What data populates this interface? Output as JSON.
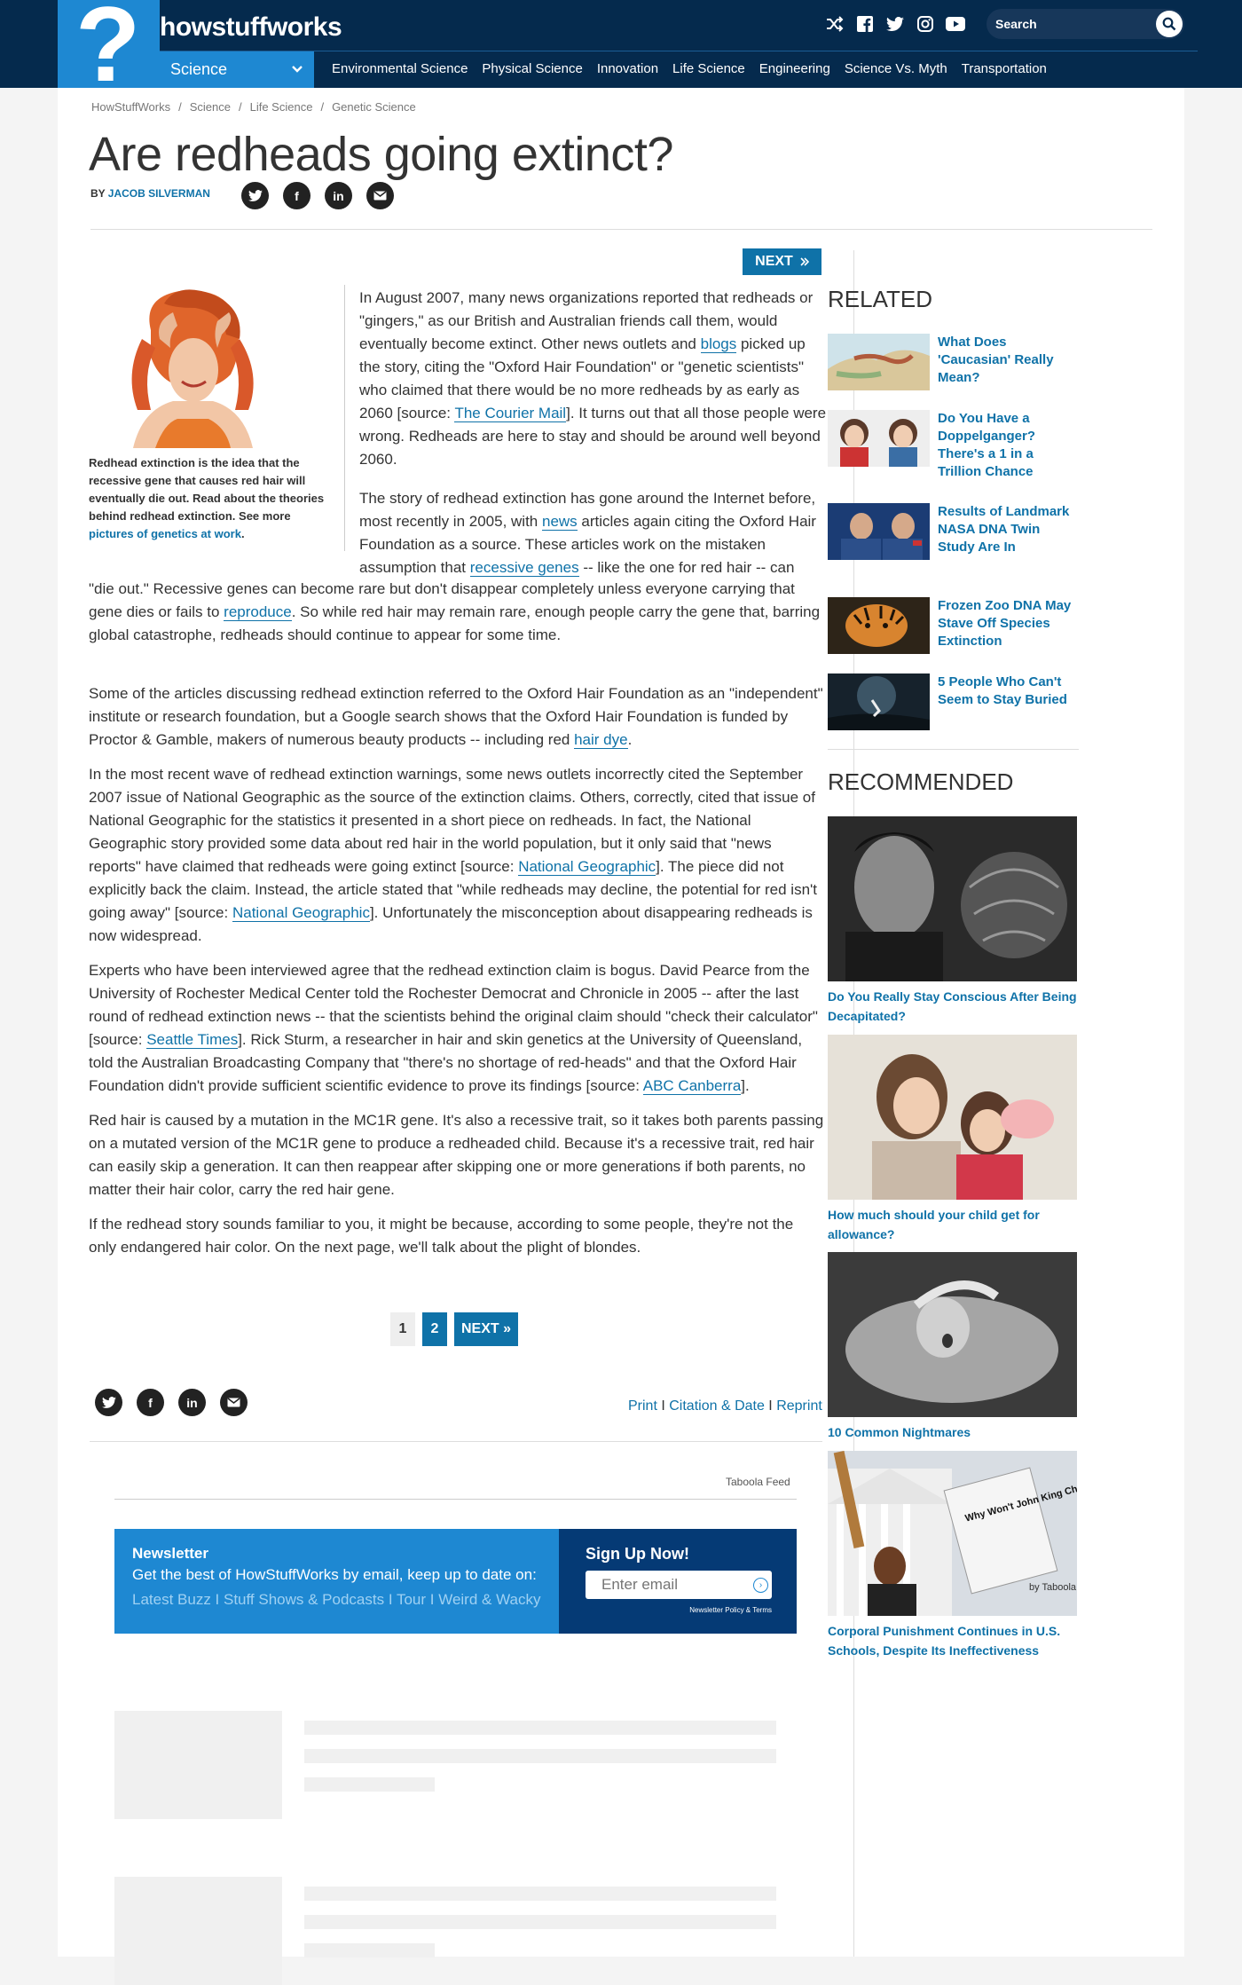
{
  "header": {
    "brand": "howstuffworks",
    "search_placeholder": "Search",
    "category": "Science",
    "nav": [
      "Environmental Science",
      "Physical Science",
      "Innovation",
      "Life Science",
      "Engineering",
      "Science Vs. Myth",
      "Transportation"
    ]
  },
  "breadcrumbs": [
    "HowStuffWorks",
    "Science",
    "Life Science",
    "Genetic Science"
  ],
  "article": {
    "title": "Are redheads going extinct?",
    "by_label": "BY",
    "author": "JACOB SILVERMAN",
    "next_label": "NEXT",
    "caption_text": "Redhead extinction is the idea that the recessive gene that causes red hair will eventually die out. Read about the theories behind redhead extinction. See more ",
    "caption_link": "pictures of genetics at work",
    "caption_end": ".",
    "p1": [
      "In August 2007, many news organizations reported that redheads or \"gingers,\" as our British and Australian friends call them, would eventually become extinct. Other news outlets and ",
      "blogs",
      " picked up the story, citing the \"Oxford Hair Foundation\" or \"genetic scientists\" who claimed that there would be no more redheads by as early as 2060 [source: ",
      "The Courier Mail",
      "]. It turns out that all those people were wrong. Redheads are here to stay and should be around well beyond 2060."
    ],
    "p2a": [
      "The story of redhead extinction has gone around the Internet before, most recently in 2005, with ",
      "news",
      " articles again citing the Oxford Hair Foundation as a source. These articles work on the mistaken assumption that ",
      "recessive genes",
      " -- like the one for red hair -- can"
    ],
    "p2b": [
      "\"die out.\" Recessive genes can become rare but don't disappear completely unless everyone carrying that gene dies or fails to ",
      "reproduce",
      ". So while red hair may remain rare, enough people carry the gene that, barring global catastrophe, redheads should continue to appear for some time."
    ],
    "p3": [
      "Some of the articles discussing redhead extinction referred to the Oxford Hair Foundation as an \"independent\" institute or research foundation, but a Google search shows that the Oxford Hair Foundation is funded by Proctor & Gamble, makers of numerous beauty products -- including red ",
      "hair dye",
      "."
    ],
    "p4": [
      "In the most recent wave of redhead extinction warnings, some news outlets incorrectly cited the September 2007 issue of National Geographic as the source of the extinction claims. Others, correctly, cited that issue of National Geographic for the statistics it presented in a short piece on redheads. In fact, the National Geographic story provided some data about red hair in the world population, but it only said that \"news reports\" have claimed that redheads were going extinct [source: ",
      "National Geographic",
      "]. The piece did not explicitly back the claim. Instead, the article stated that \"while redheads may decline, the potential for red isn't going away\" [source: ",
      "National Geographic",
      "]. Unfortunately the misconception about disappearing redheads is now widespread."
    ],
    "p5": [
      "Experts who have been interviewed agree that the redhead extinction claim is bogus. David Pearce from the University of Rochester Medical Center told the Rochester Democrat and Chronicle in 2005 -- after the last round of redhead extinction news -- that the scientists behind the original claim should \"check their calculator\" [source: ",
      "Seattle Times",
      "]. Rick Sturm, a researcher in hair and skin genetics at the University of Queensland, told the Australian Broadcasting Company that \"there's no shortage of red-heads\" and that the Oxford Hair Foundation didn't provide sufficient scientific evidence to prove its findings [source: ",
      "ABC Canberra",
      "]."
    ],
    "p6": "Red hair is caused by a mutation in the MC1R gene. It's also a recessive trait, so it takes both parents passing on a mutated version of the MC1R gene to produce a redheaded child. Because it's a recessive trait, red hair can easily skip a generation. It can then reappear after skipping one or more generations if both parents, no matter their hair color, carry the red hair gene.",
    "p7": "If the redhead story sounds familiar to you, it might be because, according to some people, they're not the only endangered hair color. On the next page, we'll talk about the plight of blondes."
  },
  "pager": {
    "p1": "1",
    "p2": "2",
    "next": "NEXT »"
  },
  "tools": {
    "print": "Print",
    "citation": "Citation & Date",
    "reprint": "Reprint",
    "sep": " I "
  },
  "taboola_feed": "Taboola Feed",
  "newsletter": {
    "title": "Newsletter",
    "desc": "Get the best of HowStuffWorks by email, keep up to date on:",
    "links": "Latest Buzz I Stuff Shows & Podcasts I Tour I Weird & Wacky",
    "signup": "Sign Up Now!",
    "placeholder": "Enter email",
    "policy": "Newsletter Policy & Terms"
  },
  "sidebar": {
    "related_heading": "RELATED",
    "related": [
      "What Does 'Caucasian' Really Mean?",
      "Do You Have a Doppelganger? There's a 1 in a Trillion Chance",
      "Results of Landmark NASA DNA Twin Study Are In",
      "Frozen Zoo DNA May Stave Off Species Extinction",
      "5 People Who Can't Seem to Stay Buried"
    ],
    "recommended_heading": "RECOMMENDED",
    "recommended": [
      "Do You Really Stay Conscious After Being Decapitated?",
      "How much should your child get for allowance?",
      "10 Common Nightmares",
      "Corporal Punishment Continues in U.S. Schools, Despite Its Ineffectiveness"
    ],
    "by_taboola": "by Taboola",
    "sign_text": "Why Won't John King Chair End USA School Beatings? Stops Here"
  },
  "colors": {
    "header_bg": "#052a4d",
    "accent": "#1e88d2",
    "link": "#0f72a8"
  }
}
